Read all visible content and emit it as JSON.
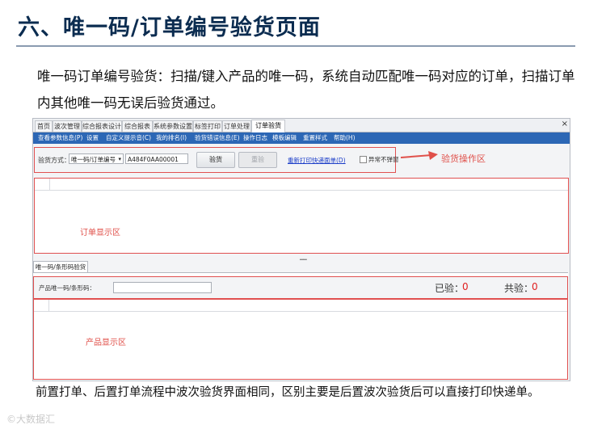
{
  "slide": {
    "title": "六、唯一码/订单编号验货页面",
    "intro": "唯一码订单编号验货：扫描/键入产品的唯一码，系统自动匹配唯一码对应的订单，扫描订单内其他唯一码无误后验货通过。",
    "outro": "前置打单、后置打单流程中波次验货界面相同，区别主要是后置波次验货后可以直接打印快递单。",
    "watermark": "©大数据汇"
  },
  "app": {
    "tabs": [
      {
        "label": "首页"
      },
      {
        "label": "波次管理"
      },
      {
        "label": "综合报表设计"
      },
      {
        "label": "综合报表"
      },
      {
        "label": "系统参数设置"
      },
      {
        "label": "标签打印"
      },
      {
        "label": "订单处理"
      },
      {
        "label": "订单验货"
      }
    ],
    "close_label": "×",
    "menu": [
      {
        "label": "查看参数信息(P)"
      },
      {
        "label": "设置"
      },
      {
        "label": "自定义提示音(C)"
      },
      {
        "label": "我的排名(I)"
      },
      {
        "label": "验货错误信息(E)"
      },
      {
        "label": "操作日志"
      },
      {
        "label": "模板编辑"
      },
      {
        "label": "重置样式"
      },
      {
        "label": "帮助(H)"
      }
    ],
    "inspect": {
      "method_label": "验货方式：",
      "method_value": "唯一码/订单编号",
      "code_value": "A484F0AA00001",
      "inspect_button": "验货",
      "reset_button": "重验",
      "reprint_link": "重新打印快递面单(D)",
      "no_popup_label": "异常不弹窗"
    },
    "order_area_label": "订单显示区",
    "sub_tab": "唯一码/条形码验货",
    "product": {
      "field_label": "产品唯一码/条形码：",
      "checked_label": "已验：",
      "checked_value": "0",
      "total_label": "共验：",
      "total_value": "0",
      "area_label": "产品显示区"
    }
  },
  "callout": {
    "label": "验货操作区"
  }
}
